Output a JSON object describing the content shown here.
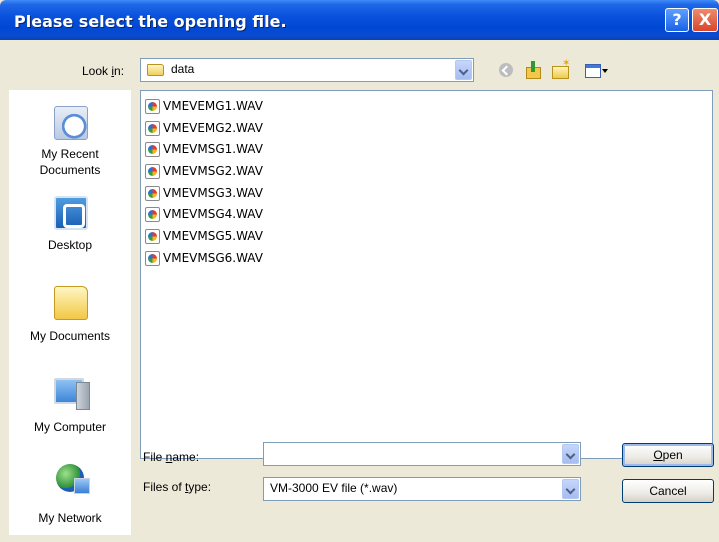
{
  "window": {
    "title": "Please select the opening file.",
    "help_label": "?",
    "close_label": "X"
  },
  "toolbar": {
    "look_in_label": "Look in:",
    "look_in_value": "data"
  },
  "places": [
    {
      "label": "My Recent Documents"
    },
    {
      "label": "Desktop"
    },
    {
      "label": "My Documents"
    },
    {
      "label": "My Computer"
    },
    {
      "label": "My Network"
    }
  ],
  "files": [
    "VMEVEMG1.WAV",
    "VMEVEMG2.WAV",
    "VMEVMSG1.WAV",
    "VMEVMSG2.WAV",
    "VMEVMSG3.WAV",
    "VMEVMSG4.WAV",
    "VMEVMSG5.WAV",
    "VMEVMSG6.WAV"
  ],
  "form": {
    "file_name_label": "File name:",
    "file_name_value": "",
    "file_type_label": "Files of type:",
    "file_type_value": "VM-3000 EV file (*.wav)"
  },
  "buttons": {
    "open_label": "Open",
    "cancel_label": "Cancel"
  }
}
